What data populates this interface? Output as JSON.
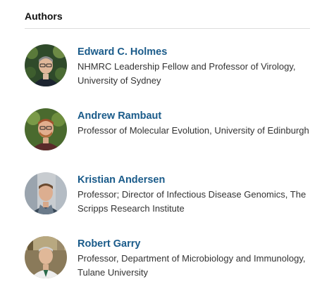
{
  "section": {
    "heading": "Authors"
  },
  "authors": [
    {
      "name": "Edward C. Holmes",
      "role": "NHMRC Leadership Fellow and Professor of Virology, University of Sydney"
    },
    {
      "name": "Andrew Rambaut",
      "role": "Professor of Molecular Evolution, University of Edinburgh"
    },
    {
      "name": "Kristian Andersen",
      "role": "Professor; Director of Infectious Disease Genomics, The Scripps Research Institute"
    },
    {
      "name": "Robert Garry",
      "role": "Professor, Department of Microbiology and Immunology, Tulane University"
    }
  ],
  "colors": {
    "link": "#1a5b8a",
    "text": "#333333",
    "divider": "#dcdcdc"
  }
}
